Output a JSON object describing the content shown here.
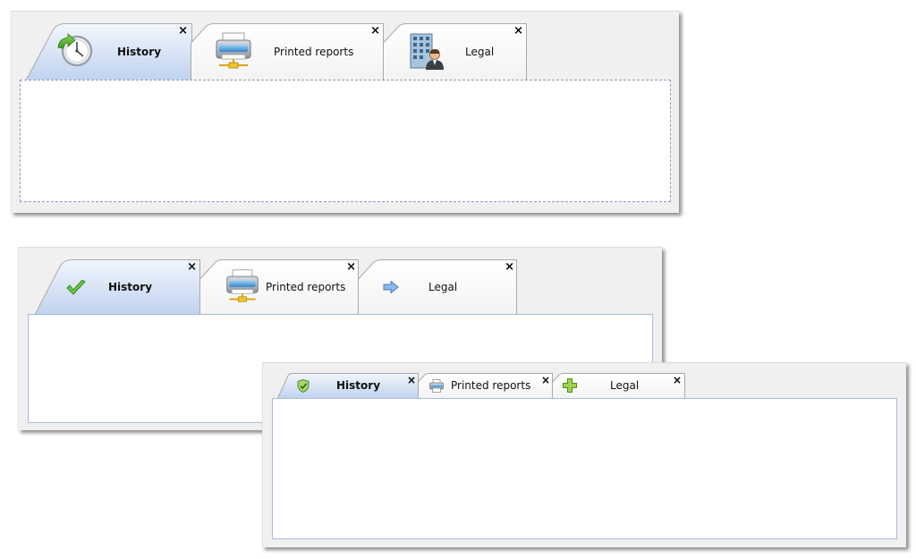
{
  "panel_large": {
    "tabs": [
      {
        "label": "History",
        "icon": "clock-icon",
        "close": "×",
        "selected": true
      },
      {
        "label": "Printed reports",
        "icon": "network-printer-icon",
        "close": "×",
        "selected": false
      },
      {
        "label": "Legal",
        "icon": "office-building-person-icon",
        "close": "×",
        "selected": false
      }
    ]
  },
  "panel_medium": {
    "tabs": [
      {
        "label": "History",
        "icon": "checkmark-icon",
        "close": "×",
        "selected": true
      },
      {
        "label": "Printed reports",
        "icon": "network-printer-icon",
        "close": "×",
        "selected": false
      },
      {
        "label": "Legal",
        "icon": "arrow-right-icon",
        "close": "×",
        "selected": false
      }
    ]
  },
  "panel_small": {
    "tabs": [
      {
        "label": "History",
        "icon": "shield-check-icon",
        "close": "×",
        "selected": true
      },
      {
        "label": "Printed reports",
        "icon": "printer-icon",
        "close": "×",
        "selected": false
      },
      {
        "label": "Legal",
        "icon": "plus-icon",
        "close": "×",
        "selected": false
      }
    ]
  },
  "colors": {
    "selected_tab_top": "#eef3fb",
    "selected_tab_bottom": "#c3d5f0",
    "unselected_tab": "#fafafa",
    "tab_border": "#a9a9a9",
    "content_border": "#aabbdd",
    "panel_background": "#f0f0f0"
  }
}
